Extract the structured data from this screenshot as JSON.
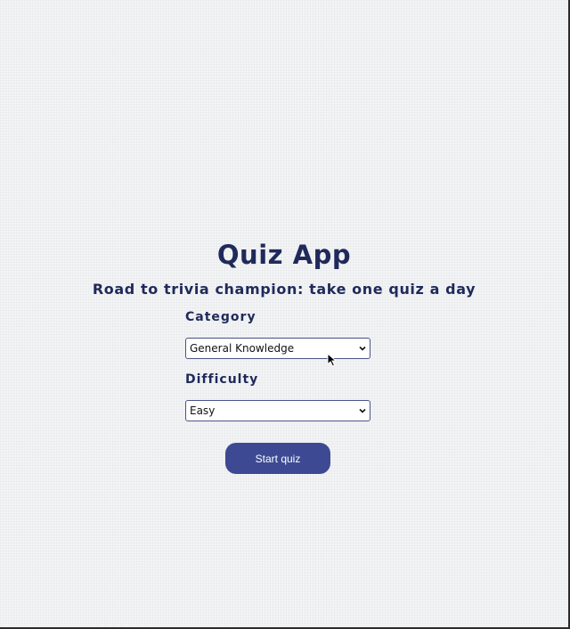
{
  "app": {
    "title": "Quiz App",
    "subtitle": "Road to trivia champion: take one quiz a day"
  },
  "form": {
    "category": {
      "label": "Category",
      "selected": "General Knowledge"
    },
    "difficulty": {
      "label": "Difficulty",
      "selected": "Easy"
    },
    "start_button": "Start quiz"
  },
  "colors": {
    "accent": "#3d4a93",
    "text": "#1f2a5a",
    "background": "#f3f4f6"
  },
  "icons": {
    "dropdown": "chevron-down-icon",
    "pointer": "mouse-cursor-icon"
  }
}
